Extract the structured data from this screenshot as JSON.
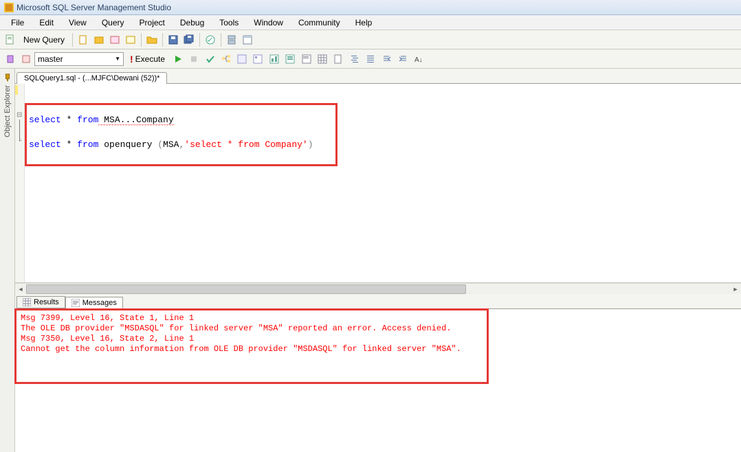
{
  "window": {
    "title": "Microsoft SQL Server Management Studio"
  },
  "menu": [
    "File",
    "Edit",
    "View",
    "Query",
    "Project",
    "Debug",
    "Tools",
    "Window",
    "Community",
    "Help"
  ],
  "toolbar1": {
    "new_query": "New Query"
  },
  "toolbar2": {
    "database": "master",
    "execute": "Execute"
  },
  "tab": {
    "label": "SQLQuery1.sql - (...MJFC\\Dewani (52))*"
  },
  "object_explorer": {
    "label": "Object Explorer"
  },
  "sql": {
    "line1_kw1": "select",
    "line1_op": " * ",
    "line1_kw2": "from",
    "line1_id": " MSA...Company",
    "line3_kw1": "select",
    "line3_op": " * ",
    "line3_kw2": "from",
    "line3_fn": " openquery ",
    "line3_p1": "(",
    "line3_arg1": "MSA",
    "line3_c": ",",
    "line3_str": "'select * from Company'",
    "line3_p2": ")"
  },
  "results_tabs": {
    "results": "Results",
    "messages": "Messages"
  },
  "messages": {
    "l1": "Msg 7399, Level 16, State 1, Line 1",
    "l2": "The OLE DB provider \"MSDASQL\" for linked server \"MSA\" reported an error. Access denied.",
    "l3": "Msg 7350, Level 16, State 2, Line 1",
    "l4": "Cannot get the column information from OLE DB provider \"MSDASQL\" for linked server \"MSA\"."
  }
}
